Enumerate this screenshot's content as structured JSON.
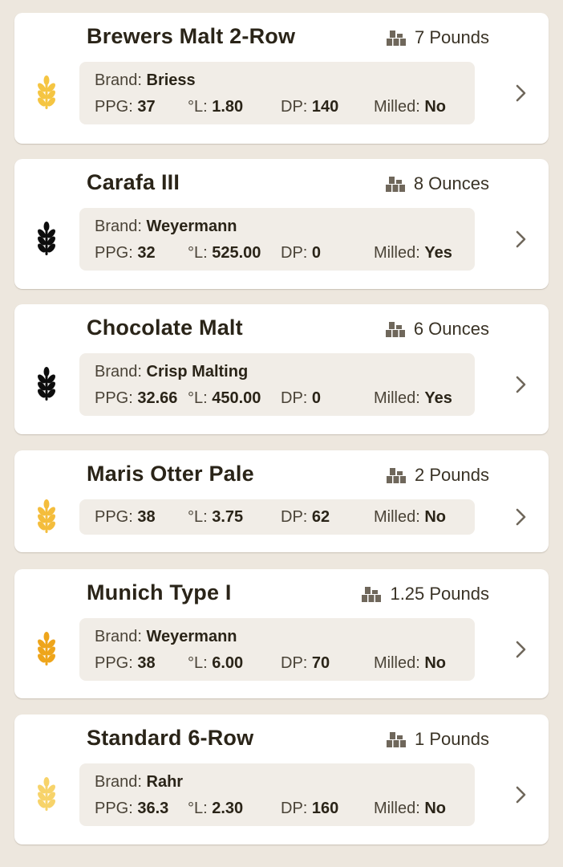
{
  "labels": {
    "brand": "Brand:",
    "ppg": "PPG:",
    "lovibond": "°L:",
    "dp": "DP:",
    "milled": "Milled:"
  },
  "grains": [
    {
      "name": "Brewers Malt 2-Row",
      "amount": "7 Pounds",
      "brand": "Briess",
      "ppg": "37",
      "lovibond": "1.80",
      "dp": "140",
      "milled": "No",
      "color": "#f5c542"
    },
    {
      "name": "Carafa III",
      "amount": "8 Ounces",
      "brand": "Weyermann",
      "ppg": "32",
      "lovibond": "525.00",
      "dp": "0",
      "milled": "Yes",
      "color": "#0d0d0d"
    },
    {
      "name": "Chocolate Malt",
      "amount": "6 Ounces",
      "brand": "Crisp Malting",
      "ppg": "32.66",
      "lovibond": "450.00",
      "dp": "0",
      "milled": "Yes",
      "color": "#0d0d0d"
    },
    {
      "name": "Maris Otter Pale",
      "amount": "2 Pounds",
      "brand": "",
      "ppg": "38",
      "lovibond": "3.75",
      "dp": "62",
      "milled": "No",
      "color": "#f4bd3c"
    },
    {
      "name": "Munich Type I",
      "amount": "1.25 Pounds",
      "brand": "Weyermann",
      "ppg": "38",
      "lovibond": "6.00",
      "dp": "70",
      "milled": "No",
      "color": "#eea51b"
    },
    {
      "name": "Standard 6-Row",
      "amount": "1 Pounds",
      "brand": "Rahr",
      "ppg": "36.3",
      "lovibond": "2.30",
      "dp": "160",
      "milled": "No",
      "color": "#f7d36a"
    }
  ]
}
